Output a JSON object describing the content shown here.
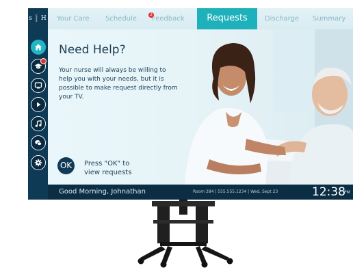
{
  "logo": {
    "text": "s ⸾ H"
  },
  "sidebar": {
    "items": [
      {
        "icon": "home-icon",
        "active": true
      },
      {
        "icon": "graduation-cap-icon",
        "badge": true
      },
      {
        "icon": "tv-icon"
      },
      {
        "icon": "play-icon"
      },
      {
        "icon": "music-note-icon"
      },
      {
        "icon": "chat-icon"
      },
      {
        "icon": "gear-icon"
      }
    ]
  },
  "tabs": [
    {
      "label": "Your Care"
    },
    {
      "label": "Schedule"
    },
    {
      "label": "Feedback",
      "badge": "2"
    },
    {
      "label": "Requests",
      "active": true
    },
    {
      "label": "Discharge"
    },
    {
      "label": "Summary"
    }
  ],
  "help": {
    "title": "Need Help?",
    "body": "Your nurse will always be willing to help you with your needs, but it is possible to make request directly from your TV.",
    "ok_button": "OK",
    "ok_prompt": "Press \"OK\" to view requests"
  },
  "footer": {
    "greeting": "Good Morning, Johnathan",
    "info": "Room 284  |  555.555.1234  |  Wed, Sept 23",
    "time": "12:38",
    "ampm": "PM"
  },
  "colors": {
    "accent": "#1fb1bb",
    "navy": "#0c2e45",
    "badge": "#e3322d"
  }
}
